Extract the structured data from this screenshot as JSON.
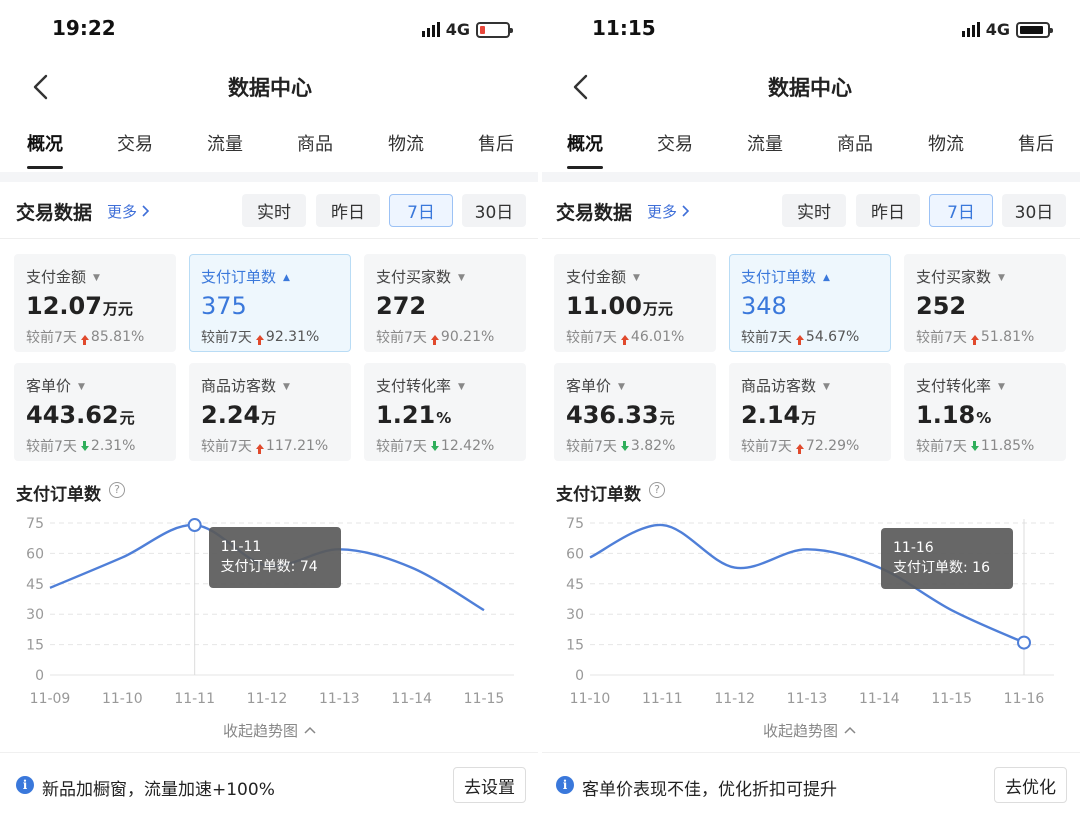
{
  "colors": {
    "accent": "#3a78db",
    "up": "#e0492c",
    "down": "#2fae5b",
    "line": "#4f7fd8"
  },
  "screens": [
    {
      "status": {
        "time": "19:22",
        "network": "4G",
        "battery_level": 0.18,
        "battery_color": "#e8473b"
      },
      "title": "数据中心",
      "tabs": [
        "概况",
        "交易",
        "流量",
        "商品",
        "物流",
        "售后"
      ],
      "active_tab": 0,
      "section": {
        "title": "交易数据",
        "more": "更多"
      },
      "ranges": [
        "实时",
        "昨日",
        "7日",
        "30日"
      ],
      "active_range": 2,
      "metrics": [
        {
          "label": "支付金额",
          "value": "12.07",
          "unit": "万元",
          "compare_label": "较前7天",
          "trend": "up",
          "change": "85.81%",
          "highlight": false
        },
        {
          "label": "支付订单数",
          "value": "375",
          "unit": "",
          "compare_label": "较前7天",
          "trend": "up",
          "change": "92.31%",
          "highlight": true
        },
        {
          "label": "支付买家数",
          "value": "272",
          "unit": "",
          "compare_label": "较前7天",
          "trend": "up",
          "change": "90.21%",
          "highlight": false
        },
        {
          "label": "客单价",
          "value": "443.62",
          "unit": "元",
          "compare_label": "较前7天",
          "trend": "down",
          "change": "2.31%",
          "highlight": false
        },
        {
          "label": "商品访客数",
          "value": "2.24",
          "unit": "万",
          "compare_label": "较前7天",
          "trend": "up",
          "change": "117.21%",
          "highlight": false
        },
        {
          "label": "支付转化率",
          "value": "1.21",
          "unit": "%",
          "compare_label": "较前7天",
          "trend": "down",
          "change": "12.42%",
          "highlight": false
        }
      ],
      "chart_title": "支付订单数",
      "chart_help": "?",
      "chart_data": {
        "type": "line",
        "x": [
          "11-09",
          "11-10",
          "11-11",
          "11-12",
          "11-13",
          "11-14",
          "11-15"
        ],
        "series": [
          {
            "values": [
              43,
              58,
              74,
              54,
              62,
              53,
              32
            ]
          }
        ],
        "y_ticks": [
          0,
          15,
          30,
          45,
          60,
          75
        ],
        "ylim": [
          0,
          75
        ],
        "grid": true,
        "tooltip": {
          "index": 2,
          "date": "11-11",
          "text": "支付订单数: 74"
        }
      },
      "collapse_label": "收起趋势图",
      "tip": {
        "text": "新品加橱窗，流量加速+100%",
        "action": "去设置"
      }
    },
    {
      "status": {
        "time": "11:15",
        "network": "4G",
        "battery_level": 0.88,
        "battery_color": "#111111"
      },
      "title": "数据中心",
      "tabs": [
        "概况",
        "交易",
        "流量",
        "商品",
        "物流",
        "售后"
      ],
      "active_tab": 0,
      "section": {
        "title": "交易数据",
        "more": "更多"
      },
      "ranges": [
        "实时",
        "昨日",
        "7日",
        "30日"
      ],
      "active_range": 2,
      "metrics": [
        {
          "label": "支付金额",
          "value": "11.00",
          "unit": "万元",
          "compare_label": "较前7天",
          "trend": "up",
          "change": "46.01%",
          "highlight": false
        },
        {
          "label": "支付订单数",
          "value": "348",
          "unit": "",
          "compare_label": "较前7天",
          "trend": "up",
          "change": "54.67%",
          "highlight": true
        },
        {
          "label": "支付买家数",
          "value": "252",
          "unit": "",
          "compare_label": "较前7天",
          "trend": "up",
          "change": "51.81%",
          "highlight": false
        },
        {
          "label": "客单价",
          "value": "436.33",
          "unit": "元",
          "compare_label": "较前7天",
          "trend": "down",
          "change": "3.82%",
          "highlight": false
        },
        {
          "label": "商品访客数",
          "value": "2.14",
          "unit": "万",
          "compare_label": "较前7天",
          "trend": "up",
          "change": "72.29%",
          "highlight": false
        },
        {
          "label": "支付转化率",
          "value": "1.18",
          "unit": "%",
          "compare_label": "较前7天",
          "trend": "down",
          "change": "11.85%",
          "highlight": false
        }
      ],
      "chart_title": "支付订单数",
      "chart_help": "?",
      "chart_data": {
        "type": "line",
        "x": [
          "11-10",
          "11-11",
          "11-12",
          "11-13",
          "11-14",
          "11-15",
          "11-16"
        ],
        "series": [
          {
            "values": [
              58,
              74,
              53,
              62,
              53,
              32,
              16
            ]
          }
        ],
        "y_ticks": [
          0,
          15,
          30,
          45,
          60,
          75
        ],
        "ylim": [
          0,
          75
        ],
        "grid": true,
        "tooltip": {
          "index": 6,
          "date": "11-16",
          "text": "支付订单数: 16"
        }
      },
      "collapse_label": "收起趋势图",
      "tip": {
        "text": "客单价表现不佳，优化折扣可提升",
        "action": "去优化"
      }
    }
  ]
}
